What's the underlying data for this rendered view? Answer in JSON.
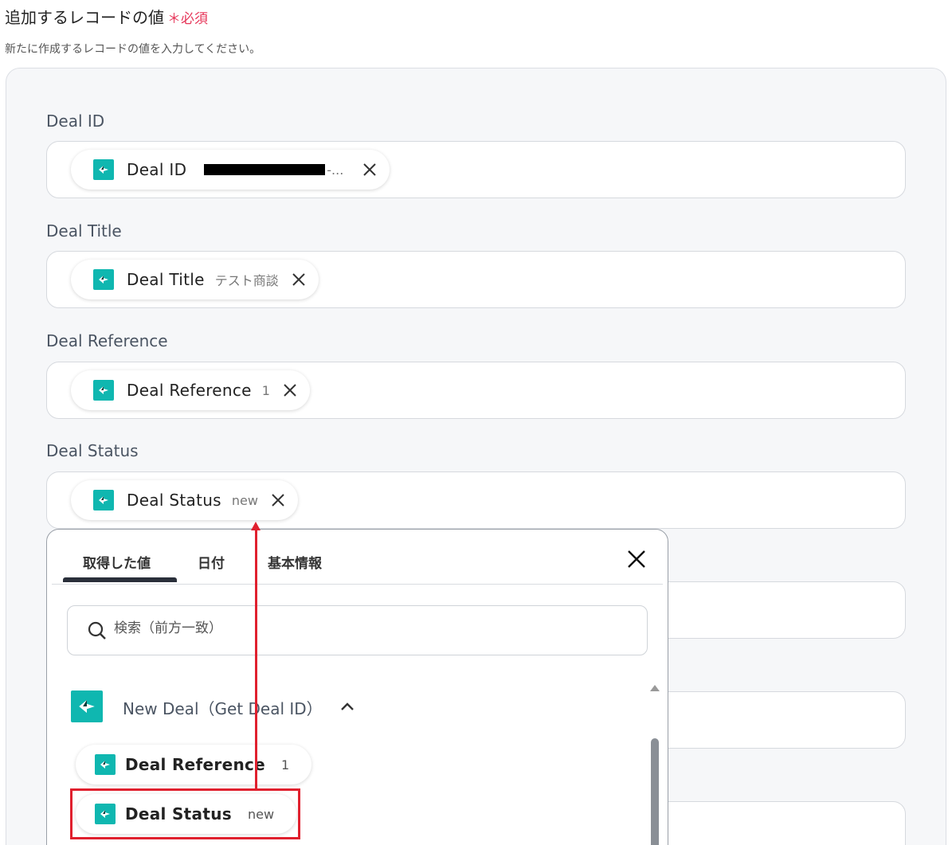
{
  "header": {
    "title": "追加するレコードの値",
    "required_mark": "＊",
    "required_label": "必須",
    "description": "新たに作成するレコードの値を入力してください。"
  },
  "fields": [
    {
      "label": "Deal ID",
      "chip_name": "Deal ID",
      "chip_value": "-..."
    },
    {
      "label": "Deal Title",
      "chip_name": "Deal Title",
      "chip_value": "テスト商談"
    },
    {
      "label": "Deal Reference",
      "chip_name": "Deal Reference",
      "chip_value": "1"
    },
    {
      "label": "Deal Status",
      "chip_name": "Deal Status",
      "chip_value": "new"
    }
  ],
  "popup": {
    "tabs": [
      "取得した値",
      "日付",
      "基本情報"
    ],
    "active_tab": "取得した値",
    "search_placeholder": "検索（前方一致）",
    "group_title": "New Deal（Get Deal ID）",
    "items": [
      {
        "name": "Deal Reference",
        "value": "1"
      },
      {
        "name": "Deal Status",
        "value": "new"
      }
    ]
  },
  "colors": {
    "brand": "#0fb7b0",
    "required": "#e6375a",
    "annotation": "#e0202e"
  },
  "icons": {
    "chip": "app-logo-icon",
    "remove": "close-icon",
    "search": "search-icon",
    "collapse": "chevron-up-icon"
  }
}
